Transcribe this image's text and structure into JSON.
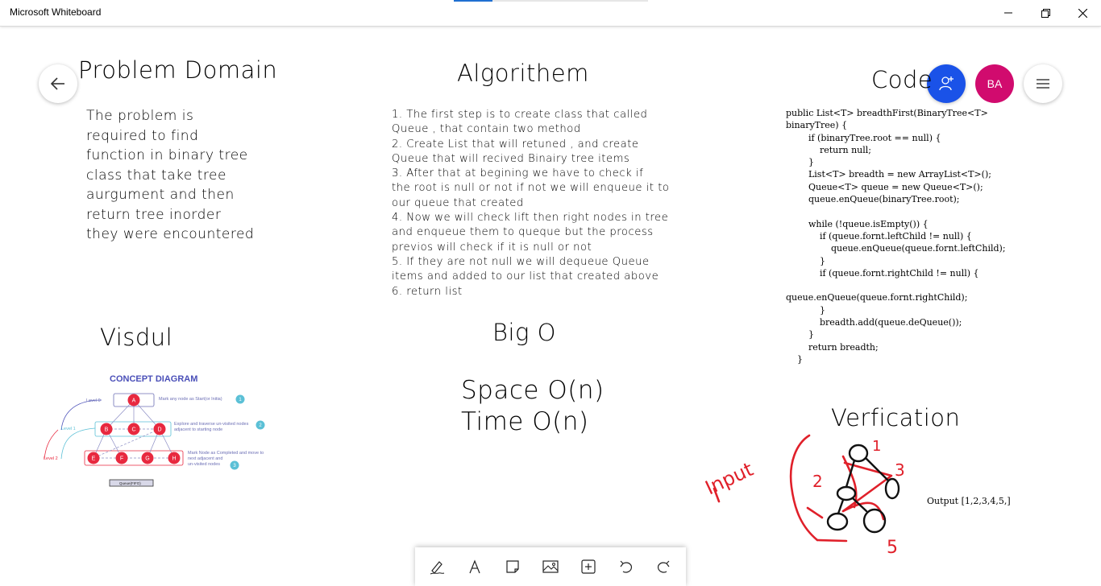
{
  "window": {
    "title": "Microsoft Whiteboard",
    "sync_progress": 0.2
  },
  "sections": {
    "problem_domain": {
      "heading": "Problem Domain",
      "body": "The problem is\nrequired to find\nfunction in binary tree\nclass that take tree\naurgument and then\nreturn tree inorder\nthey were encountered"
    },
    "algorithm": {
      "heading": "Algorithem",
      "steps": "1. The first step is to create class that called\nQueue , that contain two method\n2. Create List that will retuned , and create\nQueue that will recived Binairy tree items\n3. After that at begining we have to check if\nthe root is null or not if not we will enqueue it to\nour queue that created\n4. Now we will check lift then right nodes in tree\nand enqueue them to queque but the process\nprevios will check if it is null or not\n5. If they are not null we will dequeue Queue\nitems and added to our list that created above\n6. return list"
    },
    "code": {
      "heading": "Code",
      "source": "public List<T> breadthFirst(BinaryTree<T>\nbinaryTree) {\n        if (binaryTree.root == null) {\n            return null;\n        }\n        List<T> breadth = new ArrayList<T>();\n        Queue<T> queue = new Queue<T>();\n        queue.enQueue(binaryTree.root);\n\n        while (!queue.isEmpty()) {\n            if (queue.fornt.leftChild != null) {\n                queue.enQueue(queue.fornt.leftChild);\n            }\n            if (queue.fornt.rightChild != null) {\n\nqueue.enQueue(queue.fornt.rightChild);\n            }\n            breadth.add(queue.deQueue());\n        }\n        return breadth;\n    }"
    },
    "visual": {
      "heading": "Visdul",
      "diagram": {
        "title": "CONCEPT DIAGRAM",
        "level_labels": [
          "Level 0",
          "Level 1",
          "Level 2"
        ],
        "nodes": [
          "A",
          "B",
          "C",
          "D",
          "E",
          "F",
          "G",
          "H"
        ],
        "notes": [
          {
            "text": "Mark any node as Start(or Initia)",
            "badge": "1"
          },
          {
            "text": "Explore and traverse un-visited nodes\nadjacent to starting node",
            "badge": "2"
          },
          {
            "text": "Mark Node as Completed and move to\nnext adjacent and\nun-visited nodes",
            "badge": "3"
          }
        ],
        "footer": "Queue(FIFO)"
      }
    },
    "big_o": {
      "heading": "Big O",
      "space": "Space O(n)",
      "time": "Time O(n)"
    },
    "verification": {
      "heading": "Verfication",
      "ink_label": "Input",
      "ink_numbers": [
        "1",
        "2",
        "3",
        "5"
      ],
      "output": "Output [1,2,3,4,5,]"
    }
  },
  "controls": {
    "avatar_initials": "BA",
    "colors": {
      "share_button": "#1a52e8",
      "avatar": "#d10b6e",
      "node_fill": "#e8293f",
      "ink_red": "#e0202a",
      "diagram_title": "#4a4fb8",
      "badge": "#5bc0d6"
    }
  },
  "toolbar": {
    "tools": [
      "pen-icon",
      "text-icon",
      "sticky-note-icon",
      "image-icon",
      "insert-icon",
      "undo-icon",
      "redo-icon"
    ]
  }
}
